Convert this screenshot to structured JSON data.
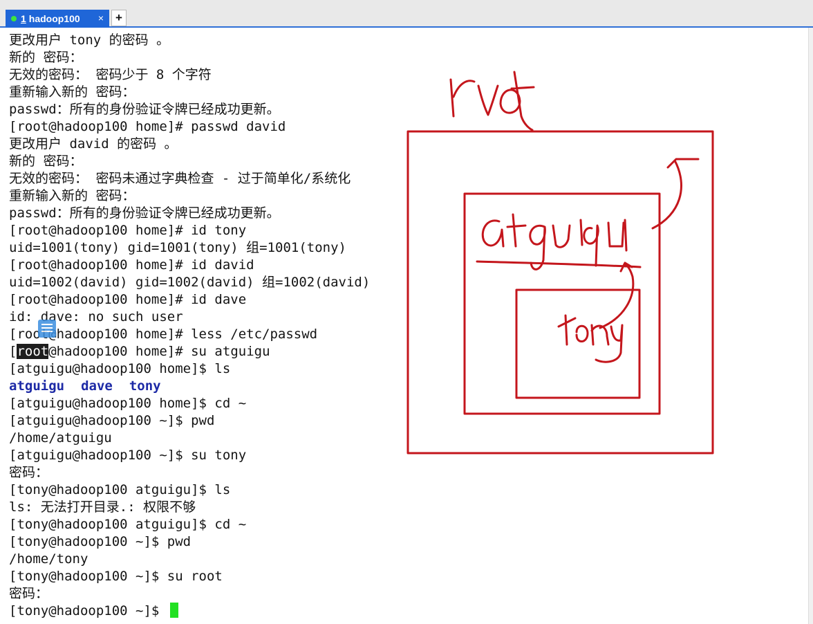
{
  "tab": {
    "index": "1",
    "title": "hadoop100",
    "close": "×",
    "add": "+"
  },
  "terminal": {
    "lines": [
      "更改用户 tony 的密码 。",
      "新的 密码：",
      "无效的密码： 密码少于 8 个字符",
      "重新输入新的 密码：",
      "passwd：所有的身份验证令牌已经成功更新。",
      "[root@hadoop100 home]# passwd david",
      "更改用户 david 的密码 。",
      "新的 密码：",
      "无效的密码： 密码未通过字典检查 - 过于简单化/系统化",
      "重新输入新的 密码：",
      "passwd：所有的身份验证令牌已经成功更新。",
      "[root@hadoop100 home]# id tony",
      "uid=1001(tony) gid=1001(tony) 组=1001(tony)",
      "[root@hadoop100 home]# id david",
      "uid=1002(david) gid=1002(david) 组=1002(david)",
      "[root@hadoop100 home]# id dave",
      "id: dave: no such user",
      "[root@hadoop100 home]# less /etc/passwd"
    ],
    "su_line": {
      "open": "[",
      "highlight": "root",
      "rest": "@hadoop100 home]# su atguigu"
    },
    "ls_prompt": "[atguigu@hadoop100 home]$ ls",
    "ls_items": [
      "atguigu",
      "dave",
      "tony"
    ],
    "lines_after": [
      "[atguigu@hadoop100 home]$ cd ~",
      "[atguigu@hadoop100 ~]$ pwd",
      "/home/atguigu",
      "[atguigu@hadoop100 ~]$ su tony",
      "密码：",
      "[tony@hadoop100 atguigu]$ ls",
      "ls: 无法打开目录.: 权限不够",
      "[tony@hadoop100 atguigu]$ cd ~",
      "[tony@hadoop100 ~]$ pwd",
      "/home/tony",
      "[tony@hadoop100 ~]$ su root",
      "密码："
    ],
    "final_prompt": "[tony@hadoop100 ~]$ "
  },
  "annotation": {
    "color": "#c4161c",
    "handwritten_labels": [
      "root",
      "atguigu",
      "tony"
    ]
  },
  "icons": [
    "close-icon",
    "add-tab-icon",
    "status-dot-icon",
    "document-icon"
  ]
}
